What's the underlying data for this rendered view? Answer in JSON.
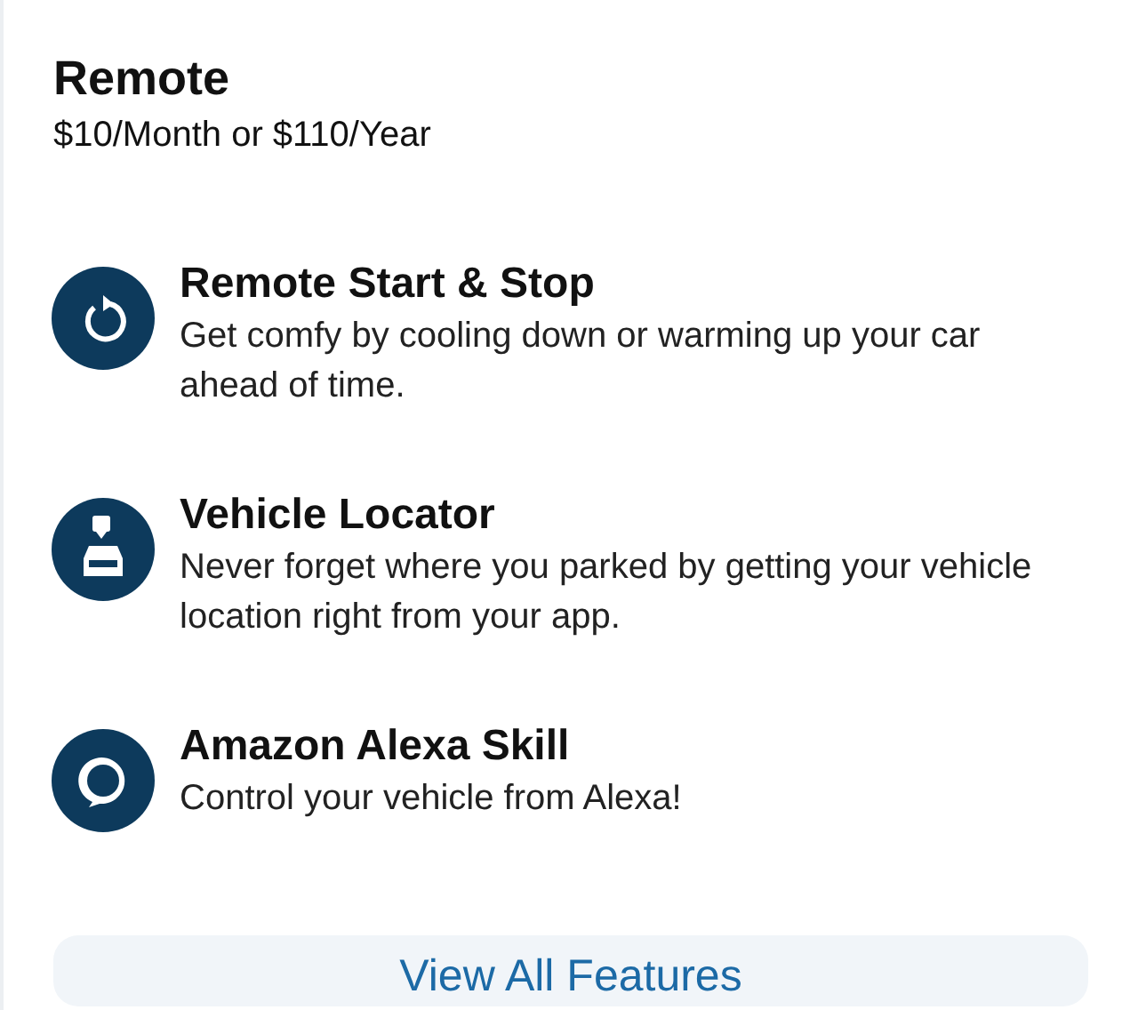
{
  "plan": {
    "title": "Remote",
    "price": "$10/Month or $110/Year"
  },
  "features": [
    {
      "kind": "remote-start",
      "title": "Remote Start & Stop",
      "description": "Get comfy by cooling down or warming up your car ahead of time."
    },
    {
      "kind": "locator",
      "title": "Vehicle Locator",
      "description": "Never forget where you parked by getting your vehicle location right from your app."
    },
    {
      "kind": "alexa",
      "title": "Amazon Alexa Skill",
      "description": "Control your vehicle from Alexa!"
    }
  ],
  "button": {
    "label": "View All Features"
  }
}
